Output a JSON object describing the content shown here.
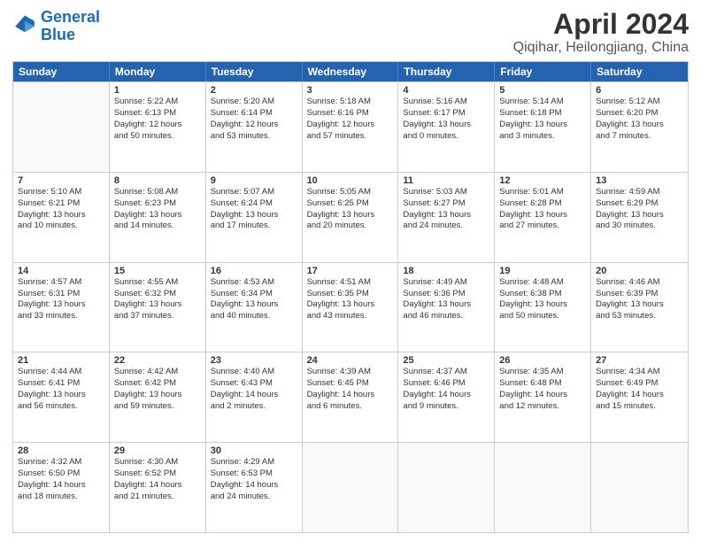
{
  "header": {
    "logo_line1": "General",
    "logo_line2": "Blue",
    "title": "April 2024",
    "subtitle": "Qiqihar, Heilongjiang, China"
  },
  "days": [
    "Sunday",
    "Monday",
    "Tuesday",
    "Wednesday",
    "Thursday",
    "Friday",
    "Saturday"
  ],
  "weeks": [
    [
      {
        "num": "",
        "lines": []
      },
      {
        "num": "1",
        "lines": [
          "Sunrise: 5:22 AM",
          "Sunset: 6:13 PM",
          "Daylight: 12 hours",
          "and 50 minutes."
        ]
      },
      {
        "num": "2",
        "lines": [
          "Sunrise: 5:20 AM",
          "Sunset: 6:14 PM",
          "Daylight: 12 hours",
          "and 53 minutes."
        ]
      },
      {
        "num": "3",
        "lines": [
          "Sunrise: 5:18 AM",
          "Sunset: 6:16 PM",
          "Daylight: 12 hours",
          "and 57 minutes."
        ]
      },
      {
        "num": "4",
        "lines": [
          "Sunrise: 5:16 AM",
          "Sunset: 6:17 PM",
          "Daylight: 13 hours",
          "and 0 minutes."
        ]
      },
      {
        "num": "5",
        "lines": [
          "Sunrise: 5:14 AM",
          "Sunset: 6:18 PM",
          "Daylight: 13 hours",
          "and 3 minutes."
        ]
      },
      {
        "num": "6",
        "lines": [
          "Sunrise: 5:12 AM",
          "Sunset: 6:20 PM",
          "Daylight: 13 hours",
          "and 7 minutes."
        ]
      }
    ],
    [
      {
        "num": "7",
        "lines": [
          "Sunrise: 5:10 AM",
          "Sunset: 6:21 PM",
          "Daylight: 13 hours",
          "and 10 minutes."
        ]
      },
      {
        "num": "8",
        "lines": [
          "Sunrise: 5:08 AM",
          "Sunset: 6:23 PM",
          "Daylight: 13 hours",
          "and 14 minutes."
        ]
      },
      {
        "num": "9",
        "lines": [
          "Sunrise: 5:07 AM",
          "Sunset: 6:24 PM",
          "Daylight: 13 hours",
          "and 17 minutes."
        ]
      },
      {
        "num": "10",
        "lines": [
          "Sunrise: 5:05 AM",
          "Sunset: 6:25 PM",
          "Daylight: 13 hours",
          "and 20 minutes."
        ]
      },
      {
        "num": "11",
        "lines": [
          "Sunrise: 5:03 AM",
          "Sunset: 6:27 PM",
          "Daylight: 13 hours",
          "and 24 minutes."
        ]
      },
      {
        "num": "12",
        "lines": [
          "Sunrise: 5:01 AM",
          "Sunset: 6:28 PM",
          "Daylight: 13 hours",
          "and 27 minutes."
        ]
      },
      {
        "num": "13",
        "lines": [
          "Sunrise: 4:59 AM",
          "Sunset: 6:29 PM",
          "Daylight: 13 hours",
          "and 30 minutes."
        ]
      }
    ],
    [
      {
        "num": "14",
        "lines": [
          "Sunrise: 4:57 AM",
          "Sunset: 6:31 PM",
          "Daylight: 13 hours",
          "and 33 minutes."
        ]
      },
      {
        "num": "15",
        "lines": [
          "Sunrise: 4:55 AM",
          "Sunset: 6:32 PM",
          "Daylight: 13 hours",
          "and 37 minutes."
        ]
      },
      {
        "num": "16",
        "lines": [
          "Sunrise: 4:53 AM",
          "Sunset: 6:34 PM",
          "Daylight: 13 hours",
          "and 40 minutes."
        ]
      },
      {
        "num": "17",
        "lines": [
          "Sunrise: 4:51 AM",
          "Sunset: 6:35 PM",
          "Daylight: 13 hours",
          "and 43 minutes."
        ]
      },
      {
        "num": "18",
        "lines": [
          "Sunrise: 4:49 AM",
          "Sunset: 6:36 PM",
          "Daylight: 13 hours",
          "and 46 minutes."
        ]
      },
      {
        "num": "19",
        "lines": [
          "Sunrise: 4:48 AM",
          "Sunset: 6:38 PM",
          "Daylight: 13 hours",
          "and 50 minutes."
        ]
      },
      {
        "num": "20",
        "lines": [
          "Sunrise: 4:46 AM",
          "Sunset: 6:39 PM",
          "Daylight: 13 hours",
          "and 53 minutes."
        ]
      }
    ],
    [
      {
        "num": "21",
        "lines": [
          "Sunrise: 4:44 AM",
          "Sunset: 6:41 PM",
          "Daylight: 13 hours",
          "and 56 minutes."
        ]
      },
      {
        "num": "22",
        "lines": [
          "Sunrise: 4:42 AM",
          "Sunset: 6:42 PM",
          "Daylight: 13 hours",
          "and 59 minutes."
        ]
      },
      {
        "num": "23",
        "lines": [
          "Sunrise: 4:40 AM",
          "Sunset: 6:43 PM",
          "Daylight: 14 hours",
          "and 2 minutes."
        ]
      },
      {
        "num": "24",
        "lines": [
          "Sunrise: 4:39 AM",
          "Sunset: 6:45 PM",
          "Daylight: 14 hours",
          "and 6 minutes."
        ]
      },
      {
        "num": "25",
        "lines": [
          "Sunrise: 4:37 AM",
          "Sunset: 6:46 PM",
          "Daylight: 14 hours",
          "and 9 minutes."
        ]
      },
      {
        "num": "26",
        "lines": [
          "Sunrise: 4:35 AM",
          "Sunset: 6:48 PM",
          "Daylight: 14 hours",
          "and 12 minutes."
        ]
      },
      {
        "num": "27",
        "lines": [
          "Sunrise: 4:34 AM",
          "Sunset: 6:49 PM",
          "Daylight: 14 hours",
          "and 15 minutes."
        ]
      }
    ],
    [
      {
        "num": "28",
        "lines": [
          "Sunrise: 4:32 AM",
          "Sunset: 6:50 PM",
          "Daylight: 14 hours",
          "and 18 minutes."
        ]
      },
      {
        "num": "29",
        "lines": [
          "Sunrise: 4:30 AM",
          "Sunset: 6:52 PM",
          "Daylight: 14 hours",
          "and 21 minutes."
        ]
      },
      {
        "num": "30",
        "lines": [
          "Sunrise: 4:29 AM",
          "Sunset: 6:53 PM",
          "Daylight: 14 hours",
          "and 24 minutes."
        ]
      },
      {
        "num": "",
        "lines": []
      },
      {
        "num": "",
        "lines": []
      },
      {
        "num": "",
        "lines": []
      },
      {
        "num": "",
        "lines": []
      }
    ]
  ]
}
